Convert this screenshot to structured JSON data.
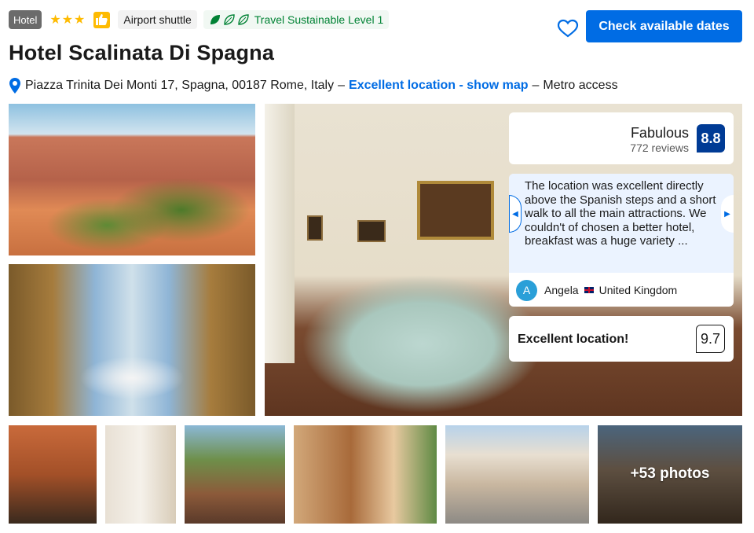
{
  "header": {
    "property_type_badge": "Hotel",
    "star_rating": 3,
    "stars_display": "★★★",
    "amenity_chip": "Airport shuttle",
    "sustainability_label": "Travel Sustainable Level 1",
    "cta_label": "Check available dates"
  },
  "hotel": {
    "name": "Hotel Scalinata Di Spagna",
    "address": "Piazza Trinita Dei Monti 17, Spagna, 00187 Rome, Italy",
    "separator": "–",
    "location_link": "Excellent location - show map",
    "transit": "Metro access"
  },
  "rating": {
    "label": "Fabulous",
    "reviews": "772 reviews",
    "score": "8.8"
  },
  "featured_review": {
    "text": "The location was excellent directly above the Spanish steps and a short walk to all the main attractions. We couldn't of chosen a better hotel, breakfast was a huge variety ...",
    "avatar_initial": "A",
    "reviewer_name": "Angela",
    "reviewer_country": "United Kingdom"
  },
  "location_score": {
    "label": "Excellent location!",
    "score": "9.7"
  },
  "gallery": {
    "more_photos_label": "+53 photos"
  },
  "colors": {
    "primary_blue": "#006ce4",
    "score_navy": "#003b95",
    "star_yellow": "#febb02",
    "sustainability_green": "#008234"
  }
}
